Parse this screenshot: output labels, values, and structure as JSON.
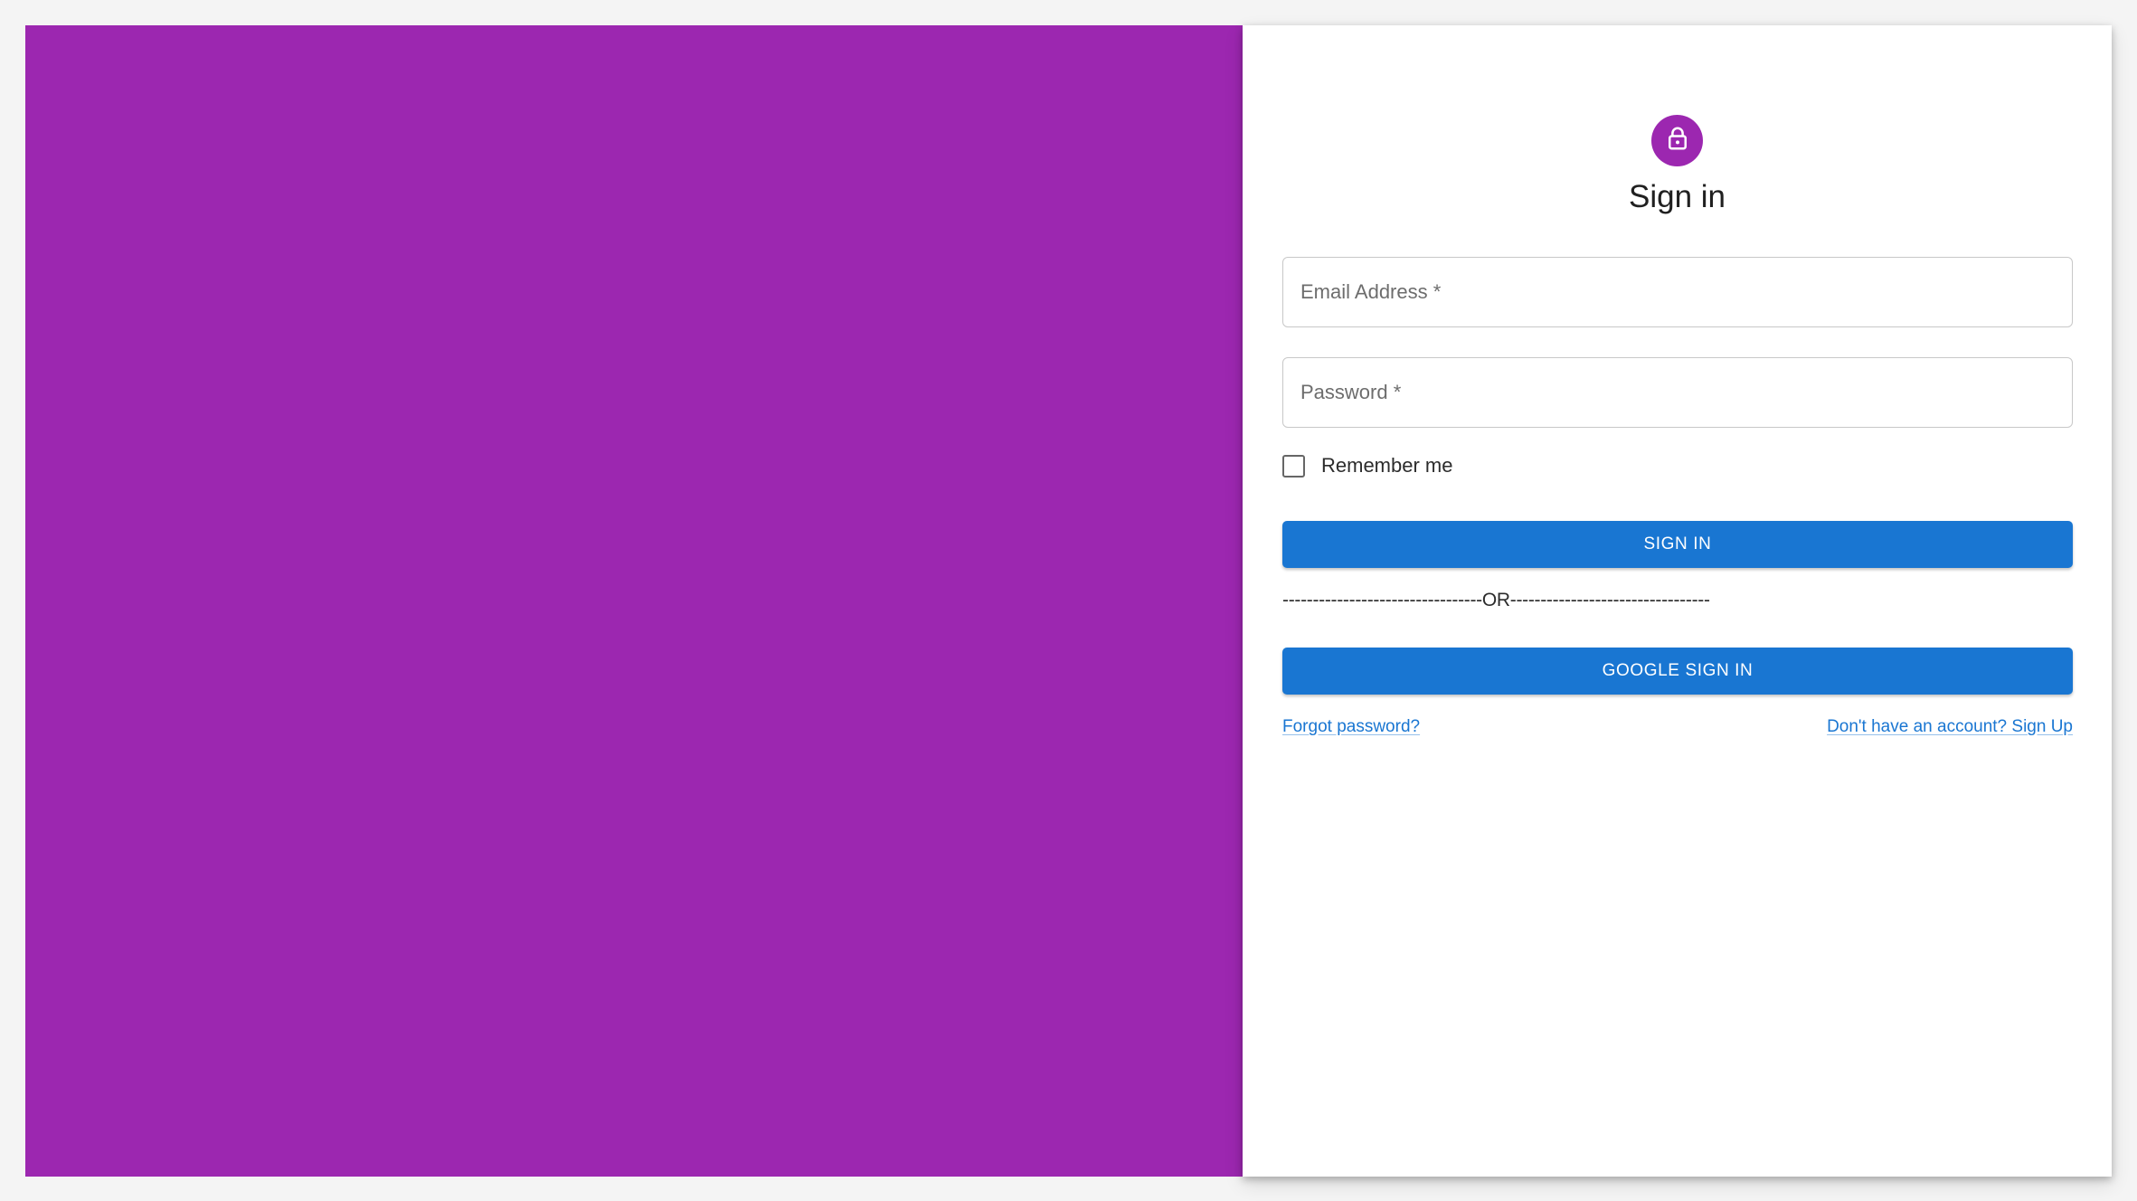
{
  "colors": {
    "hero_background": "#9c27b0",
    "avatar_background": "#9c27b0",
    "primary_button": "#1976d2",
    "link": "#1976d2"
  },
  "header": {
    "icon": "lock-icon",
    "title": "Sign in"
  },
  "form": {
    "email_placeholder": "Email Address *",
    "email_value": "",
    "password_placeholder": "Password *",
    "password_value": "",
    "remember_label": "Remember me",
    "remember_checked": false,
    "signin_label": "SIGN IN",
    "divider": "---------------------------------OR---------------------------------",
    "google_label": "GOOGLE SIGN IN"
  },
  "links": {
    "forgot": "Forgot password?",
    "signup": "Don't have an account? Sign Up"
  }
}
